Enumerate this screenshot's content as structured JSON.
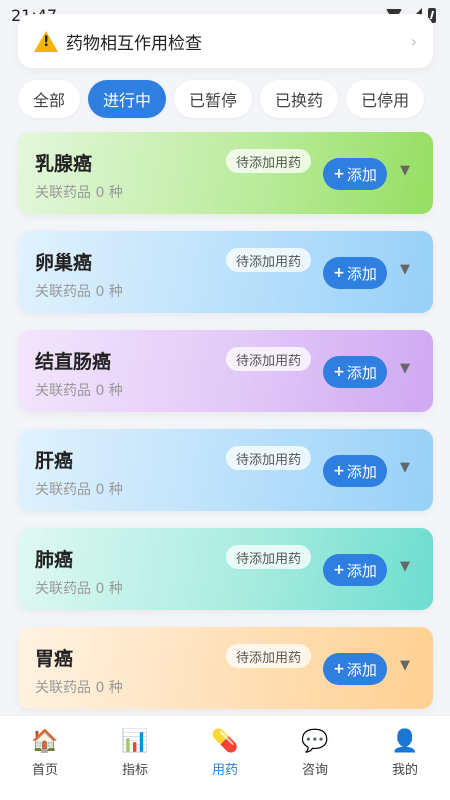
{
  "status_bar": {
    "time": "21:47"
  },
  "interaction_check": {
    "icon": "warning-icon",
    "label": "药物相互作用检查"
  },
  "filters": [
    {
      "label": "全部",
      "active": false
    },
    {
      "label": "进行中",
      "active": true
    },
    {
      "label": "已暂停",
      "active": false
    },
    {
      "label": "已换药",
      "active": false
    },
    {
      "label": "已停用",
      "active": false
    }
  ],
  "cards": [
    {
      "title": "乳腺癌",
      "badge": "待添加用药",
      "subtitle": "关联药品 0 种",
      "add_label": "添加",
      "color_theme": "green"
    },
    {
      "title": "卵巢癌",
      "badge": "待添加用药",
      "subtitle": "关联药品 0 种",
      "add_label": "添加",
      "color_theme": "blue"
    },
    {
      "title": "结直肠癌",
      "badge": "待添加用药",
      "subtitle": "关联药品 0 种",
      "add_label": "添加",
      "color_theme": "purple"
    },
    {
      "title": "肝癌",
      "badge": "待添加用药",
      "subtitle": "关联药品 0 种",
      "add_label": "添加",
      "color_theme": "blue"
    },
    {
      "title": "肺癌",
      "badge": "待添加用药",
      "subtitle": "关联药品 0 种",
      "add_label": "添加",
      "color_theme": "teal"
    },
    {
      "title": "胃癌",
      "badge": "待添加用药",
      "subtitle": "关联药品 0 种",
      "add_label": "添加",
      "color_theme": "orange"
    }
  ],
  "nav": [
    {
      "label": "首页",
      "icon": "home-icon",
      "active": false
    },
    {
      "label": "指标",
      "icon": "chart-icon",
      "active": false
    },
    {
      "label": "用药",
      "icon": "pill-icon",
      "active": true
    },
    {
      "label": "咨询",
      "icon": "chat-icon",
      "active": false
    },
    {
      "label": "我的",
      "icon": "profile-icon",
      "active": false
    }
  ],
  "colors": {
    "accent": "#2f7fe0",
    "warning": "#f5b400"
  }
}
